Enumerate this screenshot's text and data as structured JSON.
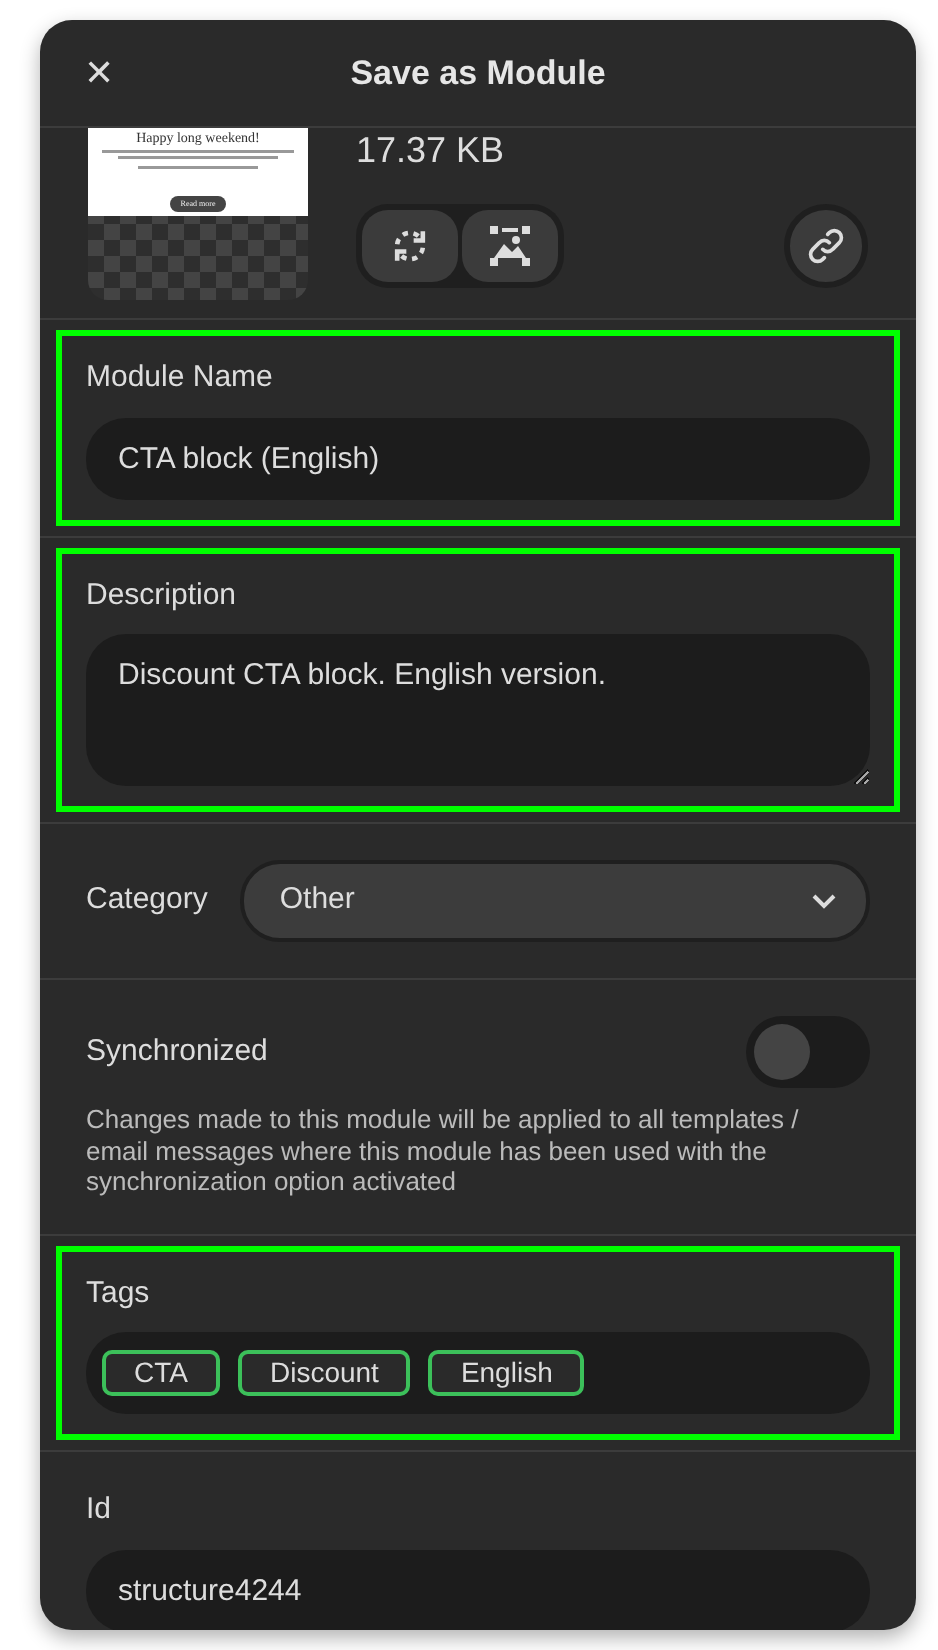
{
  "window": {
    "title": "Save as Module",
    "close": "✕"
  },
  "preview": {
    "heading": "Happy long weekend!",
    "button": "Read more",
    "size": "17.37 KB"
  },
  "fields": [
    {
      "kind": "input",
      "label": "Module Name",
      "value": "CTA block (English)",
      "highlighted": true
    },
    {
      "kind": "textarea",
      "label": "Description",
      "value": "Discount CTA block. English version.",
      "highlighted": true
    },
    {
      "kind": "select",
      "label": "Category",
      "value": "Other",
      "highlighted": false
    },
    {
      "kind": "toggle",
      "label": "Synchronized",
      "on": false,
      "help": "Changes made to this module will be applied to all templates / email messages where this module has been used with the synchronization option activated",
      "highlighted": false
    },
    {
      "kind": "tags",
      "label": "Tags",
      "tags": [
        "CTA",
        "Discount",
        "English"
      ],
      "highlighted": true
    },
    {
      "kind": "input",
      "label": "Id",
      "value": "structure4244",
      "highlighted": false
    }
  ]
}
